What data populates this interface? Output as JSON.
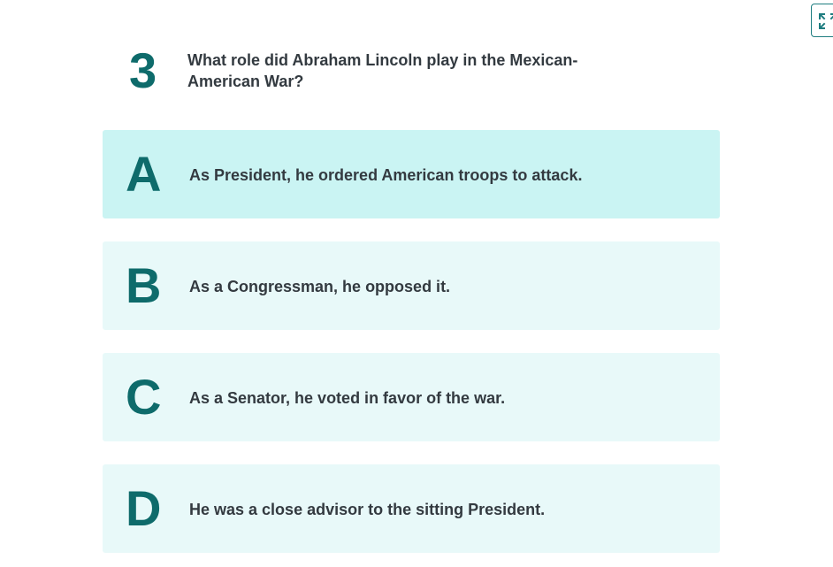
{
  "question": {
    "number": "3",
    "text": "What role did Abraham Lincoln play in the Mexican-American War?"
  },
  "options": [
    {
      "letter": "A",
      "text": "As President, he ordered American troops to attack.",
      "state": "highlighted"
    },
    {
      "letter": "B",
      "text": "As a Congressman, he opposed it.",
      "state": "default"
    },
    {
      "letter": "C",
      "text": "As a Senator, he voted in favor of the war.",
      "state": "default"
    },
    {
      "letter": "D",
      "text": "He was a close advisor to the sitting President.",
      "state": "default"
    }
  ],
  "toolbar": {
    "fullscreen_icon": "expand-icon"
  },
  "colors": {
    "accent": "#0e6b6b",
    "option_bg": "#e8f9f9",
    "option_highlight_bg": "#caf4f3",
    "text": "#333a40"
  }
}
